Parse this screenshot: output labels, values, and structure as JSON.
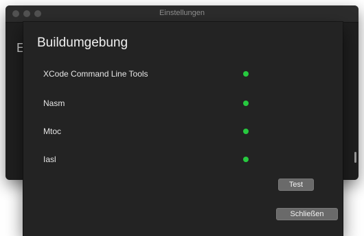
{
  "window": {
    "title": "Einstellungen",
    "background_heading": "E"
  },
  "sheet": {
    "title": "Buildumgebung",
    "items": [
      {
        "label": "XCode Command Line Tools",
        "status": "ok",
        "status_color": "#27c93f"
      },
      {
        "label": "Nasm",
        "status": "ok",
        "status_color": "#27c93f"
      },
      {
        "label": "Mtoc",
        "status": "ok",
        "status_color": "#27c93f"
      },
      {
        "label": "Iasl",
        "status": "ok",
        "status_color": "#27c93f"
      }
    ],
    "buttons": {
      "test_label": "Test",
      "close_label": "Schließen"
    }
  }
}
